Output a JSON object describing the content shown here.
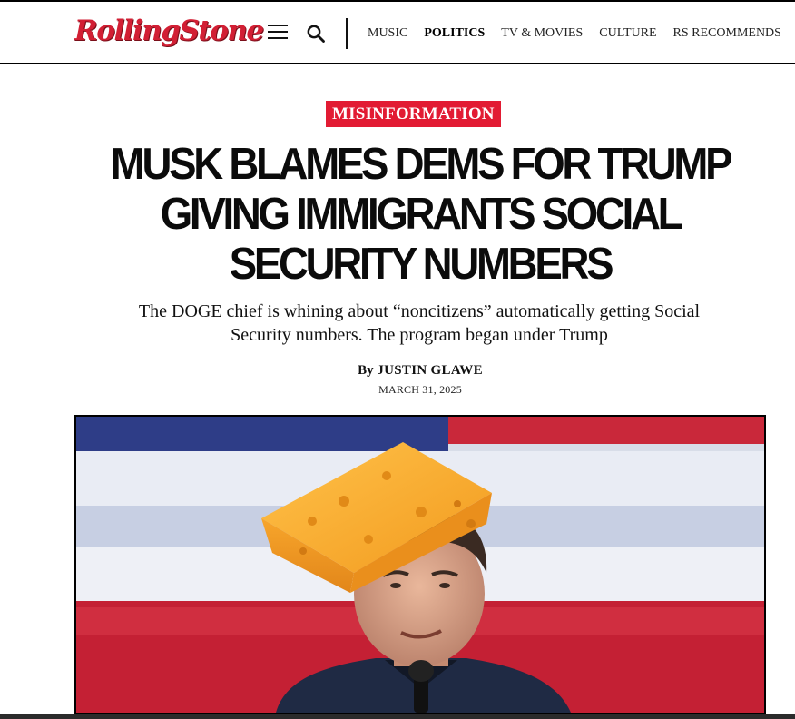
{
  "header": {
    "logo_text": "RollingStone",
    "nav": [
      {
        "label": "MUSIC",
        "active": false
      },
      {
        "label": "POLITICS",
        "active": true
      },
      {
        "label": "TV & MOVIES",
        "active": false
      },
      {
        "label": "CULTURE",
        "active": false
      },
      {
        "label": "RS RECOMMENDS",
        "active": false
      }
    ],
    "icons": {
      "menu": "hamburger-menu-icon",
      "search": "search-icon"
    }
  },
  "article": {
    "category": "MISINFORMATION",
    "headline": "MUSK BLAMES DEMS FOR TRUMP GIVING IMMIGRANTS SOCIAL SECURITY NUMBERS",
    "dek": "The DOGE chief is whining about “noncitizens” automatically getting Social Security numbers. The program began under Trump",
    "byline_prefix": "By",
    "author": "JUSTIN GLAWE",
    "date": "MARCH 31, 2025"
  },
  "colors": {
    "brand_red": "#d21f34",
    "badge_red": "#e21b33",
    "text": "#111111"
  }
}
